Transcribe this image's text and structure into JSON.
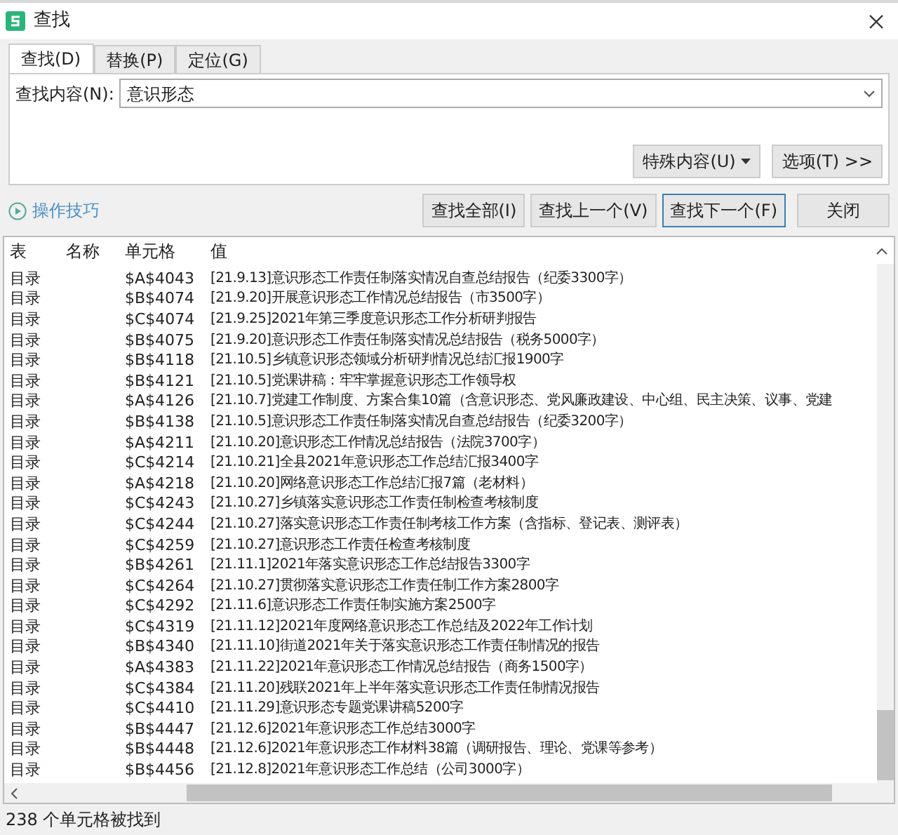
{
  "window": {
    "title": "查找"
  },
  "tabs": [
    {
      "label": "查找(D)",
      "selected": true
    },
    {
      "label": "替换(P)",
      "selected": false
    },
    {
      "label": "定位(G)",
      "selected": false
    }
  ],
  "find_field": {
    "label": "查找内容(N):",
    "value": "意识形态"
  },
  "option_buttons": [
    {
      "label": "特殊内容(U)",
      "kind": "dropdown"
    },
    {
      "label": "选项(T) >>",
      "kind": "plain"
    }
  ],
  "tips_link": "操作技巧",
  "action_buttons": [
    {
      "label": "查找全部(I)",
      "selected": false
    },
    {
      "label": "查找上一个(V)",
      "selected": false
    },
    {
      "label": "查找下一个(F)",
      "selected": true
    },
    {
      "label": "关闭",
      "selected": false
    }
  ],
  "results": {
    "columns": [
      "表",
      "名称",
      "单元格",
      "值"
    ],
    "rows": [
      {
        "sheet": "目录",
        "cell": "$A$4043",
        "value": "[21.9.13]意识形态工作责任制落实情况自查总结报告（纪委3300字）"
      },
      {
        "sheet": "目录",
        "cell": "$B$4074",
        "value": "[21.9.20]开展意识形态工作情况总结报告（市3500字）"
      },
      {
        "sheet": "目录",
        "cell": "$C$4074",
        "value": "[21.9.25]2021年第三季度意识形态工作分析研判报告"
      },
      {
        "sheet": "目录",
        "cell": "$B$4075",
        "value": "[21.9.20]意识形态工作责任制落实情况总结报告（税务5000字）"
      },
      {
        "sheet": "目录",
        "cell": "$B$4118",
        "value": "[21.10.5]乡镇意识形态领域分析研判情况总结汇报1900字"
      },
      {
        "sheet": "目录",
        "cell": "$B$4121",
        "value": "[21.10.5]党课讲稿：牢牢掌握意识形态工作领导权"
      },
      {
        "sheet": "目录",
        "cell": "$A$4126",
        "value": "[21.10.7]党建工作制度、方案合集10篇（含意识形态、党风廉政建设、中心组、民主决策、议事、党建"
      },
      {
        "sheet": "目录",
        "cell": "$B$4138",
        "value": "[21.10.5]意识形态工作责任制落实情况自查总结报告（纪委3200字）"
      },
      {
        "sheet": "目录",
        "cell": "$A$4211",
        "value": "[21.10.20]意识形态工作情况总结报告（法院3700字）"
      },
      {
        "sheet": "目录",
        "cell": "$C$4214",
        "value": "[21.10.21]全县2021年意识形态工作总结汇报3400字"
      },
      {
        "sheet": "目录",
        "cell": "$A$4218",
        "value": "[21.10.20]网络意识形态工作总结汇报7篇（老材料）"
      },
      {
        "sheet": "目录",
        "cell": "$C$4243",
        "value": "[21.10.27]乡镇落实意识形态工作责任制检查考核制度"
      },
      {
        "sheet": "目录",
        "cell": "$C$4244",
        "value": "[21.10.27]落实意识形态工作责任制考核工作方案（含指标、登记表、测评表）"
      },
      {
        "sheet": "目录",
        "cell": "$C$4259",
        "value": "[21.10.27]意识形态工作责任检查考核制度"
      },
      {
        "sheet": "目录",
        "cell": "$B$4261",
        "value": "[21.11.1]2021年落实意识形态工作总结报告3300字"
      },
      {
        "sheet": "目录",
        "cell": "$C$4264",
        "value": "[21.10.27]贯彻落实意识形态工作责任制工作方案2800字"
      },
      {
        "sheet": "目录",
        "cell": "$C$4292",
        "value": "[21.11.6]意识形态工作责任制实施方案2500字"
      },
      {
        "sheet": "目录",
        "cell": "$C$4319",
        "value": "[21.11.12]2021年度网络意识形态工作总结及2022年工作计划"
      },
      {
        "sheet": "目录",
        "cell": "$B$4340",
        "value": "[21.11.10]街道2021年关于落实意识形态工作责任制情况的报告"
      },
      {
        "sheet": "目录",
        "cell": "$A$4383",
        "value": "[21.11.22]2021年意识形态工作情况总结报告（商务1500字）"
      },
      {
        "sheet": "目录",
        "cell": "$C$4384",
        "value": "[21.11.20]残联2021年上半年落实意识形态工作责任制情况报告"
      },
      {
        "sheet": "目录",
        "cell": "$C$4410",
        "value": "[21.11.29]意识形态专题党课讲稿5200字"
      },
      {
        "sheet": "目录",
        "cell": "$B$4447",
        "value": "[21.12.6]2021年意识形态工作总结3000字"
      },
      {
        "sheet": "目录",
        "cell": "$B$4448",
        "value": "[21.12.6]2021年意识形态工作材料38篇（调研报告、理论、党课等参考）"
      },
      {
        "sheet": "目录",
        "cell": "$B$4456",
        "value": "[21.12.8]2021年意识形态工作总结（公司3000字）"
      }
    ]
  },
  "status_bar": "238 个单元格被找到"
}
